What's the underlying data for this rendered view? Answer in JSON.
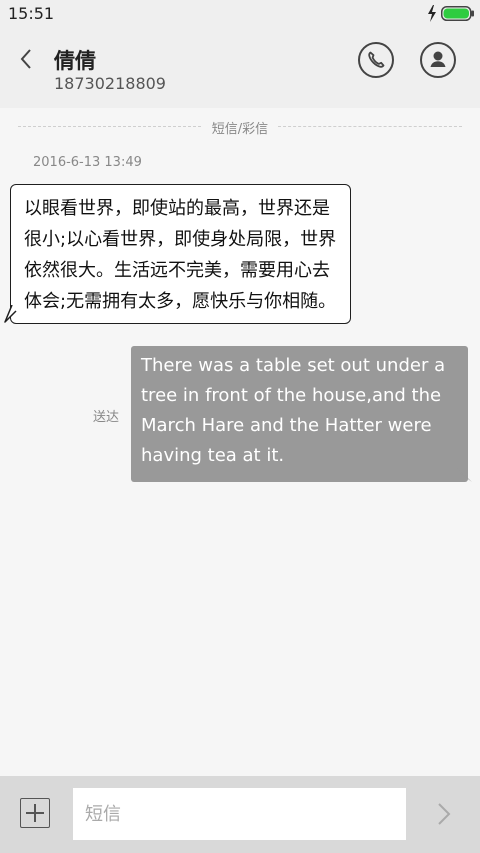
{
  "status_bar": {
    "time": "15:51",
    "battery_color": "#2fcc40"
  },
  "header": {
    "contact_name": "倩倩",
    "contact_number": "18730218809"
  },
  "thread": {
    "divider_label": "短信/彩信",
    "timestamp": "2016-6-13 13:49",
    "messages": [
      {
        "direction": "incoming",
        "lines": [
          "以眼看世界，即使站的最高，世界还是",
          "很小;以心看世界，即使身处局限，世界",
          "依然很大。生活远不完美，需要用心去",
          "体会;无需拥有太多，愿快乐与你相随。"
        ]
      },
      {
        "direction": "outgoing",
        "status": "送达",
        "lines": [
          "There was a table set out under a",
          "tree in front of the house,and the",
          "March Hare and the Hatter were",
          "having tea at it."
        ]
      }
    ]
  },
  "composer": {
    "placeholder": "短信",
    "value": ""
  },
  "icons": {
    "back": "chevron-left-icon",
    "call": "phone-icon",
    "contact": "person-icon",
    "add": "plus-icon",
    "send": "chevron-right-icon",
    "charging": "bolt-icon",
    "battery": "battery-icon"
  }
}
